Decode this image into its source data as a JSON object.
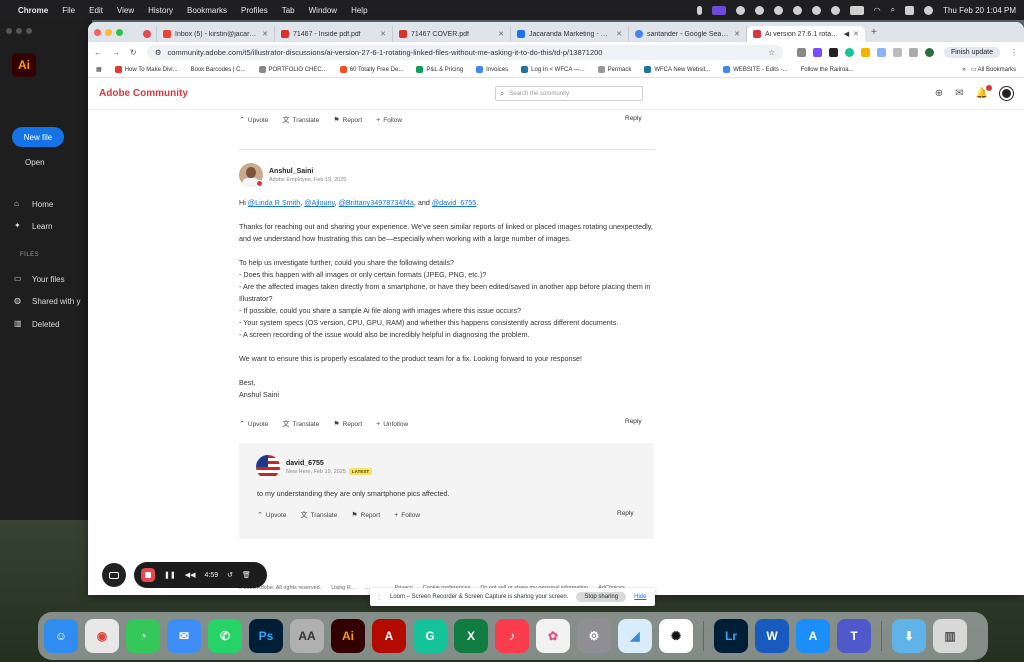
{
  "menubar": {
    "app": "Chrome",
    "items": [
      "File",
      "Edit",
      "View",
      "History",
      "Bookmarks",
      "Profiles",
      "Tab",
      "Window",
      "Help"
    ],
    "clock": "Thu Feb 20  1:04 PM"
  },
  "cc": {
    "logo": "Ai",
    "new_file": "New file",
    "open": "Open",
    "nav": [
      {
        "label": "Home",
        "icon": "home-icon"
      },
      {
        "label": "Learn",
        "icon": "lightbulb-icon"
      }
    ],
    "files_header": "FILES",
    "files": [
      {
        "label": "Your files",
        "icon": "file-icon"
      },
      {
        "label": "Shared with y",
        "icon": "shared-users-icon"
      },
      {
        "label": "Deleted",
        "icon": "trash-icon"
      }
    ]
  },
  "tabs": [
    {
      "label": "Inbox (5) - kirstin@jacaranda",
      "color": "#ea4335"
    },
    {
      "label": "71467 - Inside pdf.pdf",
      "color": "#d93025"
    },
    {
      "label": "71467 COVER.pdf",
      "color": "#d93025"
    },
    {
      "label": "Jacaranda Marketing - Calen",
      "color": "#1a73e8"
    },
    {
      "label": "santander - Google Search",
      "color": "#4285f4"
    },
    {
      "label": "Ai version 27.6.1 rotating",
      "color": "#d7373f",
      "active": true
    }
  ],
  "address": {
    "url": "community.adobe.com/t5/illustrator-discussions/ai-version-27-6-1-rotating-linked-files-without-me-asking-it-to-do-this/td-p/13871200",
    "finish_update": "Finish update"
  },
  "bookmarks": [
    {
      "label": "How To Make Divi...",
      "color": "#e53935"
    },
    {
      "label": "Book Barcodes | C...",
      "color": "#555"
    },
    {
      "label": "PORTFOLIO CHEC...",
      "color": "#888"
    },
    {
      "label": "60 Totally Free De...",
      "color": "#f4511e"
    },
    {
      "label": "P&L & Pricing",
      "color": "#0f9d58"
    },
    {
      "label": "Invoices",
      "color": "#4285f4"
    },
    {
      "label": "Log In < WFCA —...",
      "color": "#21759b"
    },
    {
      "label": "Permack",
      "color": "#999"
    },
    {
      "label": "WFCA New Websit...",
      "color": "#21759b"
    },
    {
      "label": "WEBSITE - Edits -...",
      "color": "#4285f4"
    },
    {
      "label": "Follow the Railroa...",
      "color": "#777"
    }
  ],
  "all_bookmarks": "All Bookmarks",
  "site": {
    "brand": "Adobe Community",
    "search_placeholder": "Search the community"
  },
  "actions": {
    "upvote": "Upvote",
    "translate": "Translate",
    "report": "Report",
    "follow": "Follow",
    "unfollow": "Unfollow",
    "reply": "Reply"
  },
  "post": {
    "author": "Anshul_Saini",
    "meta": "Adobe Employee, Feb 19, 2025",
    "greeting_prefix": "Hi ",
    "mentions": [
      "@Linda R Smith",
      "@Ajlouny",
      "@Brittany34978734lf4a",
      "@david_6755"
    ],
    "greeting_and": ", and ",
    "p1": "Thanks for reaching out and sharing your experience. We've seen similar reports of linked or placed images rotating unexpectedly, and we understand how frustrating this can be—especially when working with a large number of images.",
    "p2": "To help us investigate further, could you share the following details?",
    "bullets": [
      "- Does this happen with all images or only certain formats (JPEG, PNG, etc.)?",
      "- Are the affected images taken directly from a smartphone, or have they been edited/saved in another app before placing them in Illustrator?",
      "- If possible, could you share a sample Ai file along with images where this issue occurs?",
      "- Your system specs (OS version, CPU, GPU, RAM) and whether this happens consistently across different documents.",
      "- A screen recording of the issue would also be incredibly helpful in diagnosing the problem."
    ],
    "p3": "We want to ensure this is properly escalated to the product team for a fix. Looking forward to your response!",
    "signoff": "Best,",
    "signature": "Anshul Saini"
  },
  "reply_post": {
    "author": "david_6755",
    "meta": "New Here, Feb 19, 2025",
    "badge": "LATEST",
    "text": "to my understanding they are only smartphone pics affected."
  },
  "footer": [
    "© 2025 Adobe. All rights reserved.",
    "Using R...",
    "...",
    "...",
    "Privacy",
    "Cookie preferences",
    "Do not sell or share my personal information",
    "AdChoices"
  ],
  "loom": {
    "timer": "4:59",
    "banner_text": "Loom – Screen Recorder & Screen Capture is sharing your screen.",
    "stop_sharing": "Stop sharing",
    "hide": "Hide"
  },
  "dock": [
    {
      "name": "finder",
      "color": "#2f8cf0",
      "glyph": "☺"
    },
    {
      "name": "chrome",
      "color": "#e8e8e8",
      "glyph": "◉"
    },
    {
      "name": "messages",
      "color": "#34c759",
      "glyph": "💬"
    },
    {
      "name": "mail",
      "color": "#3d8ef7",
      "glyph": "✉"
    },
    {
      "name": "whatsapp",
      "color": "#25d366",
      "glyph": "✆"
    },
    {
      "name": "photoshop",
      "color": "#001e36",
      "glyph": "Ps"
    },
    {
      "name": "font-book",
      "color": "#b0b0b0",
      "glyph": "AA"
    },
    {
      "name": "illustrator",
      "color": "#330000",
      "glyph": "Ai"
    },
    {
      "name": "acrobat",
      "color": "#b30b00",
      "glyph": "A"
    },
    {
      "name": "grammarly",
      "color": "#15c39a",
      "glyph": "G"
    },
    {
      "name": "excel",
      "color": "#107c41",
      "glyph": "X"
    },
    {
      "name": "music",
      "color": "#fa3c4c",
      "glyph": "♪"
    },
    {
      "name": "photos",
      "color": "#f2f2f2",
      "glyph": "✿"
    },
    {
      "name": "system-settings",
      "color": "#8e8e93",
      "glyph": "⚙"
    },
    {
      "name": "preview",
      "color": "#d9ecfa",
      "glyph": "◢"
    },
    {
      "name": "chatgpt",
      "color": "#ffffff",
      "glyph": "✺"
    },
    {
      "name": "lightroom",
      "color": "#001e36",
      "glyph": "Lr"
    },
    {
      "name": "word",
      "color": "#185abd",
      "glyph": "W"
    },
    {
      "name": "app-store",
      "color": "#1c8ef9",
      "glyph": "A"
    },
    {
      "name": "teams",
      "color": "#5059c9",
      "glyph": "T"
    },
    {
      "name": "downloads-folder",
      "color": "#5fb3e8",
      "glyph": "⬇"
    },
    {
      "name": "trash",
      "color": "#d8d8d8",
      "glyph": "🗑"
    }
  ]
}
